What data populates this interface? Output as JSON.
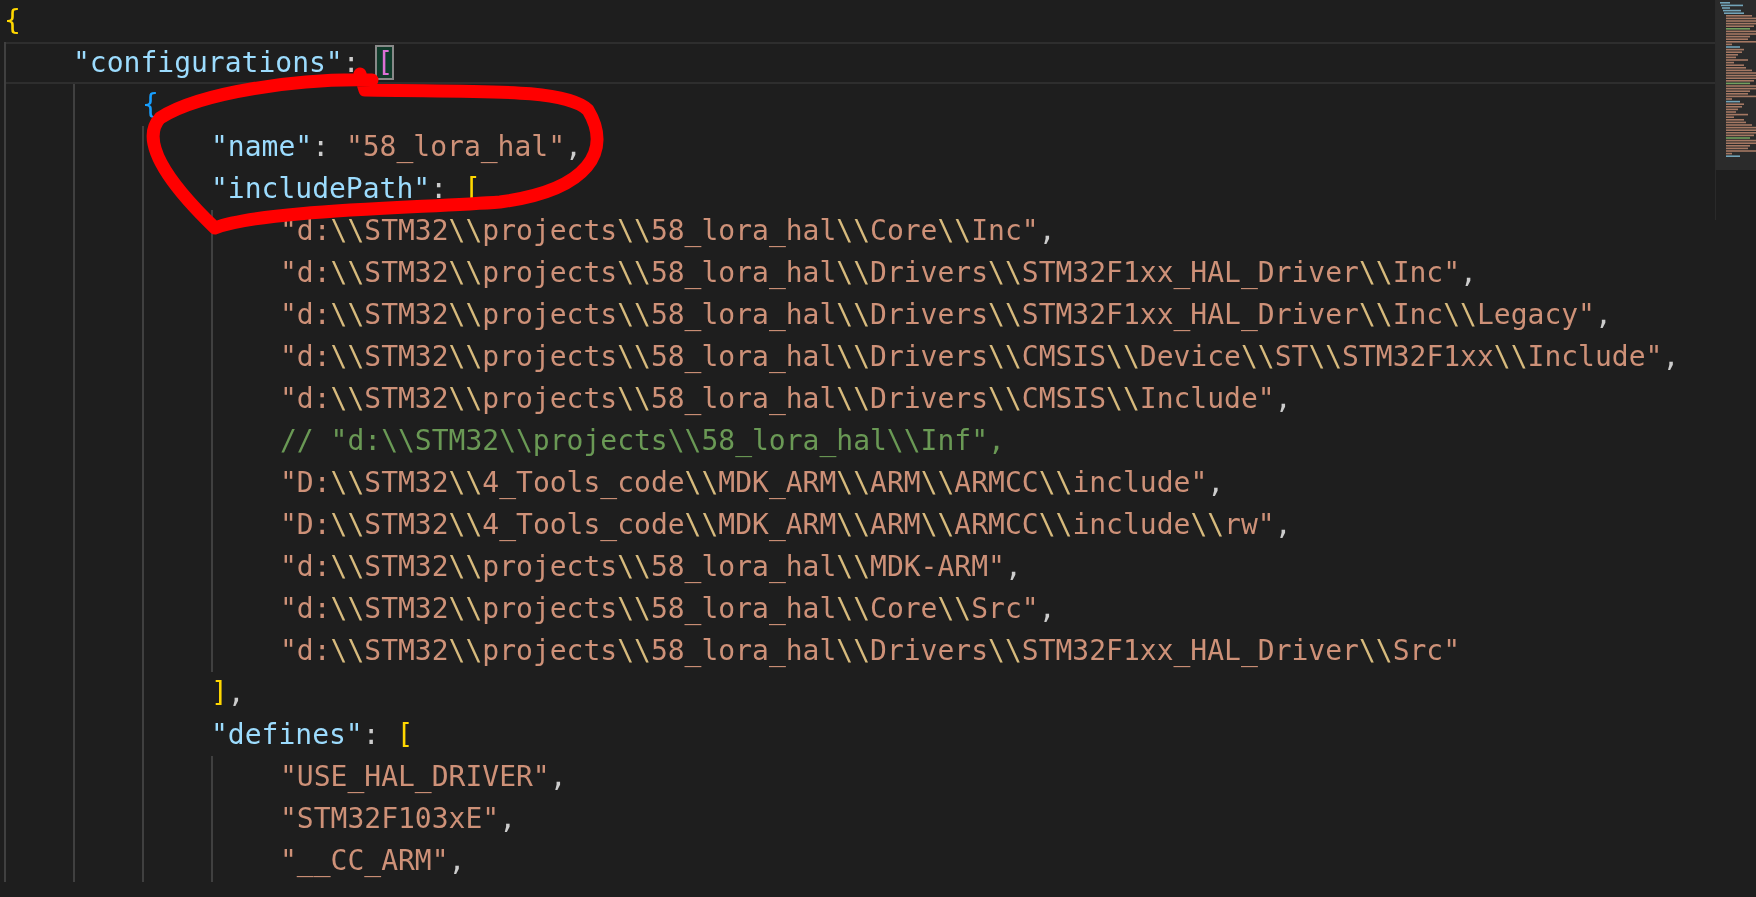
{
  "editor": {
    "lines": [
      {
        "current": false,
        "tokens": [
          {
            "kind": "b1",
            "text": "{"
          }
        ],
        "children": [
          {
            "current": true,
            "tokens": [
              {
                "kind": "key",
                "text": "\"configurations\""
              },
              {
                "kind": "punct",
                "text": ": "
              },
              {
                "kind": "b2",
                "text": "[",
                "matched": true
              }
            ],
            "children": [
              {
                "current": false,
                "tokens": [
                  {
                    "kind": "b3",
                    "text": "{"
                  }
                ],
                "children": [
                  {
                    "current": false,
                    "tokens": [
                      {
                        "kind": "key",
                        "text": "\"name\""
                      },
                      {
                        "kind": "punct",
                        "text": ": "
                      },
                      {
                        "kind": "string",
                        "text": "\"58_lora_hal\""
                      },
                      {
                        "kind": "punct",
                        "text": ","
                      }
                    ]
                  },
                  {
                    "current": false,
                    "tokens": [
                      {
                        "kind": "key",
                        "text": "\"includePath\""
                      },
                      {
                        "kind": "punct",
                        "text": ": "
                      },
                      {
                        "kind": "b1",
                        "text": "["
                      }
                    ],
                    "children": [
                      {
                        "current": false,
                        "tokens": [
                          {
                            "kind": "string",
                            "text": "\"d:\\\\STM32\\\\projects\\\\58_lora_hal\\\\Core\\\\Inc\""
                          },
                          {
                            "kind": "punct",
                            "text": ","
                          }
                        ]
                      },
                      {
                        "current": false,
                        "tokens": [
                          {
                            "kind": "string",
                            "text": "\"d:\\\\STM32\\\\projects\\\\58_lora_hal\\\\Drivers\\\\STM32F1xx_HAL_Driver\\\\Inc\""
                          },
                          {
                            "kind": "punct",
                            "text": ","
                          }
                        ]
                      },
                      {
                        "current": false,
                        "tokens": [
                          {
                            "kind": "string",
                            "text": "\"d:\\\\STM32\\\\projects\\\\58_lora_hal\\\\Drivers\\\\STM32F1xx_HAL_Driver\\\\Inc\\\\Legacy\""
                          },
                          {
                            "kind": "punct",
                            "text": ","
                          }
                        ]
                      },
                      {
                        "current": false,
                        "tokens": [
                          {
                            "kind": "string",
                            "text": "\"d:\\\\STM32\\\\projects\\\\58_lora_hal\\\\Drivers\\\\CMSIS\\\\Device\\\\ST\\\\STM32F1xx\\\\Include\""
                          },
                          {
                            "kind": "punct",
                            "text": ","
                          }
                        ]
                      },
                      {
                        "current": false,
                        "tokens": [
                          {
                            "kind": "string",
                            "text": "\"d:\\\\STM32\\\\projects\\\\58_lora_hal\\\\Drivers\\\\CMSIS\\\\Include\""
                          },
                          {
                            "kind": "punct",
                            "text": ","
                          }
                        ]
                      },
                      {
                        "current": false,
                        "tokens": [
                          {
                            "kind": "comment",
                            "text": "// \"d:\\\\STM32\\\\projects\\\\58_lora_hal\\\\Inf\","
                          }
                        ]
                      },
                      {
                        "current": false,
                        "tokens": [
                          {
                            "kind": "string",
                            "text": "\"D:\\\\STM32\\\\4_Tools_code\\\\MDK_ARM\\\\ARM\\\\ARMCC\\\\include\""
                          },
                          {
                            "kind": "punct",
                            "text": ","
                          }
                        ]
                      },
                      {
                        "current": false,
                        "tokens": [
                          {
                            "kind": "string",
                            "text": "\"D:\\\\STM32\\\\4_Tools_code\\\\MDK_ARM\\\\ARM\\\\ARMCC\\\\include\\\\rw\""
                          },
                          {
                            "kind": "punct",
                            "text": ","
                          }
                        ]
                      },
                      {
                        "current": false,
                        "tokens": [
                          {
                            "kind": "string",
                            "text": "\"d:\\\\STM32\\\\projects\\\\58_lora_hal\\\\MDK-ARM\""
                          },
                          {
                            "kind": "punct",
                            "text": ","
                          }
                        ]
                      },
                      {
                        "current": false,
                        "tokens": [
                          {
                            "kind": "string",
                            "text": "\"d:\\\\STM32\\\\projects\\\\58_lora_hal\\\\Core\\\\Src\""
                          },
                          {
                            "kind": "punct",
                            "text": ","
                          }
                        ]
                      },
                      {
                        "current": false,
                        "tokens": [
                          {
                            "kind": "string",
                            "text": "\"d:\\\\STM32\\\\projects\\\\58_lora_hal\\\\Drivers\\\\STM32F1xx_HAL_Driver\\\\Src\""
                          }
                        ]
                      }
                    ]
                  },
                  {
                    "current": false,
                    "tokens": [
                      {
                        "kind": "b1",
                        "text": "]"
                      },
                      {
                        "kind": "punct",
                        "text": ","
                      }
                    ]
                  },
                  {
                    "current": false,
                    "tokens": [
                      {
                        "kind": "key",
                        "text": "\"defines\""
                      },
                      {
                        "kind": "punct",
                        "text": ": "
                      },
                      {
                        "kind": "b1",
                        "text": "["
                      }
                    ],
                    "children": [
                      {
                        "current": false,
                        "tokens": [
                          {
                            "kind": "string",
                            "text": "\"USE_HAL_DRIVER\""
                          },
                          {
                            "kind": "punct",
                            "text": ","
                          }
                        ]
                      },
                      {
                        "current": false,
                        "tokens": [
                          {
                            "kind": "string",
                            "text": "\"STM32F103xE\""
                          },
                          {
                            "kind": "punct",
                            "text": ","
                          }
                        ]
                      },
                      {
                        "current": false,
                        "tokens": [
                          {
                            "kind": "string",
                            "text": "\"__CC_ARM\""
                          },
                          {
                            "kind": "punct",
                            "text": ","
                          }
                        ]
                      }
                    ]
                  }
                ]
              }
            ]
          }
        ]
      }
    ]
  }
}
